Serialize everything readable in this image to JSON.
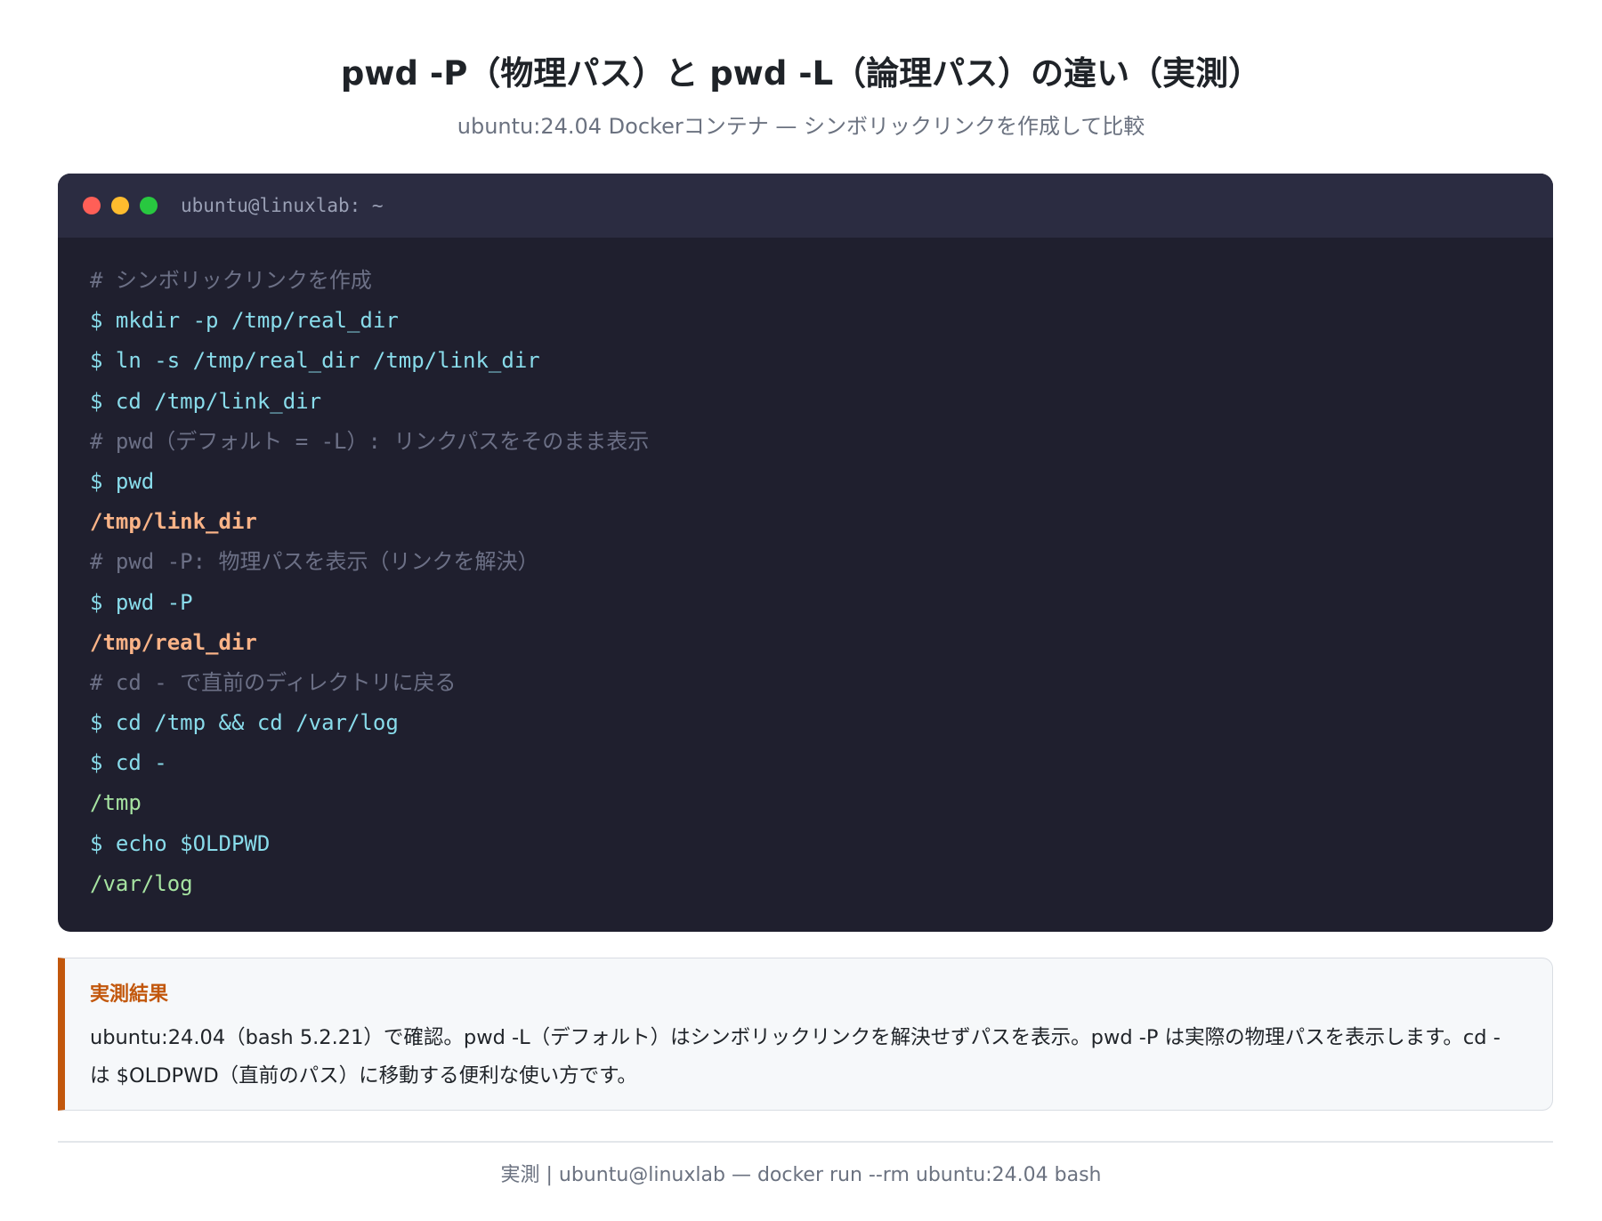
{
  "header": {
    "title": "pwd -P（物理パス）と pwd -L（論理パス）の違い（実測）",
    "subtitle": "ubuntu:24.04 Dockerコンテナ — シンボリックリンクを作成して比較"
  },
  "terminal": {
    "title": "ubuntu@linuxlab: ~",
    "lines": [
      {
        "type": "comment",
        "text": "# シンボリックリンクを作成"
      },
      {
        "type": "command",
        "text": "$ mkdir -p /tmp/real_dir"
      },
      {
        "type": "command",
        "text": "$ ln -s /tmp/real_dir /tmp/link_dir"
      },
      {
        "type": "command",
        "text": "$ cd /tmp/link_dir"
      },
      {
        "type": "comment",
        "text": "# pwd（デフォルト = -L）: リンクパスをそのまま表示"
      },
      {
        "type": "command",
        "text": "$ pwd"
      },
      {
        "type": "output-path",
        "text": "/tmp/link_dir"
      },
      {
        "type": "comment",
        "text": "# pwd -P: 物理パスを表示（リンクを解決）"
      },
      {
        "type": "command",
        "text": "$ pwd -P"
      },
      {
        "type": "output-path",
        "text": "/tmp/real_dir"
      },
      {
        "type": "comment",
        "text": "# cd - で直前のディレクトリに戻る"
      },
      {
        "type": "command",
        "text": "$ cd /tmp && cd /var/log"
      },
      {
        "type": "command",
        "text": "$ cd -"
      },
      {
        "type": "output",
        "text": "/tmp"
      },
      {
        "type": "command",
        "text": "$ echo $OLDPWD"
      },
      {
        "type": "output",
        "text": "/var/log"
      }
    ]
  },
  "result": {
    "heading": "実測結果",
    "text": "ubuntu:24.04（bash 5.2.21）で確認。pwd -L（デフォルト）はシンボリックリンクを解決せずパスを表示。pwd -P は実際の物理パスを表示します。cd - は $OLDPWD（直前のパス）に移動する便利な使い方です。"
  },
  "footer": {
    "text": "実測 | ubuntu@linuxlab — docker run --rm ubuntu:24.04 bash"
  },
  "colors": {
    "terminal_bg": "#1f1f2e",
    "terminal_bar": "#2b2c41",
    "comment": "#6c7086",
    "command": "#89dceb",
    "output_path": "#fab387",
    "output": "#a6e3a1",
    "accent": "#c2570c"
  }
}
